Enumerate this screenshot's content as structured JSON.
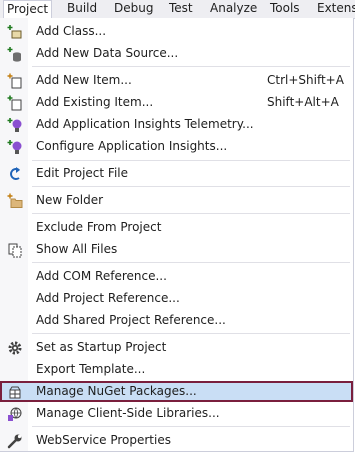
{
  "menubar": {
    "tabs": [
      "Project",
      "Build",
      "Debug",
      "Test",
      "Analyze",
      "Tools",
      "Extensi"
    ],
    "active": "Project"
  },
  "menu": {
    "items": [
      {
        "label": "Add Class...",
        "shortcut": "",
        "icon": "add-class-icon"
      },
      {
        "label": "Add New Data Source...",
        "shortcut": "",
        "icon": "add-data-source-icon"
      },
      {
        "label": "Add New Item...",
        "shortcut": "Ctrl+Shift+A",
        "icon": "add-new-item-icon"
      },
      {
        "label": "Add Existing Item...",
        "shortcut": "Shift+Alt+A",
        "icon": "add-existing-item-icon"
      },
      {
        "label": "Add Application Insights Telemetry...",
        "shortcut": "",
        "icon": "insights-telemetry-icon"
      },
      {
        "label": "Configure Application Insights...",
        "shortcut": "",
        "icon": "configure-insights-icon"
      },
      {
        "label": "Edit Project File",
        "shortcut": "",
        "icon": "edit-project-icon"
      },
      {
        "label": "New Folder",
        "shortcut": "",
        "icon": "new-folder-icon"
      },
      {
        "label": "Exclude From Project",
        "shortcut": "",
        "icon": ""
      },
      {
        "label": "Show All Files",
        "shortcut": "",
        "icon": "show-all-files-icon"
      },
      {
        "label": "Add COM Reference...",
        "shortcut": "",
        "icon": ""
      },
      {
        "label": "Add Project Reference...",
        "shortcut": "",
        "icon": ""
      },
      {
        "label": "Add Shared Project Reference...",
        "shortcut": "",
        "icon": ""
      },
      {
        "label": "Set as Startup Project",
        "shortcut": "",
        "icon": "gear-icon"
      },
      {
        "label": "Export Template...",
        "shortcut": "",
        "icon": ""
      },
      {
        "label": "Manage NuGet Packages...",
        "shortcut": "",
        "icon": "nuget-icon",
        "highlighted": true
      },
      {
        "label": "Manage Client-Side Libraries...",
        "shortcut": "",
        "icon": "client-libraries-icon"
      },
      {
        "label": "WebService Properties",
        "shortcut": "",
        "icon": "wrench-icon"
      }
    ]
  },
  "colors": {
    "highlight_bg": "#c9def5",
    "highlight_border": "#7a1f3d",
    "menubar_bg": "#eeeef2"
  }
}
